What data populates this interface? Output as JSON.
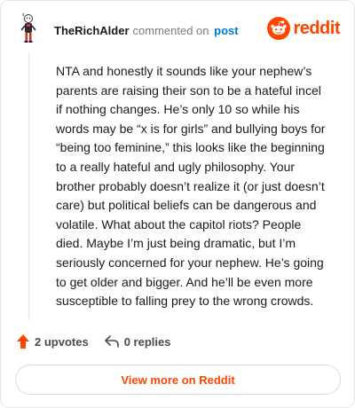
{
  "header": {
    "username": "TheRichAlder",
    "action_text": "commented on",
    "target_link": "post"
  },
  "brand": {
    "wordmark": "reddit",
    "logo_icon": "reddit-snoo-icon",
    "accent_color": "#ff4500"
  },
  "comment": {
    "lines": [
      "NTA and honestly it sounds like your nephew’s",
      "parents are raising their son to be a hateful incel",
      "if nothing changes. He’s only 10 so while his",
      "words may be “x is for girls” and bullying boys for",
      "“being too feminine,” this looks like the beginning",
      "to a really hateful and ugly philosophy. Your",
      "brother probably doesn’t realize it (or just doesn’t",
      "care) but political beliefs can be dangerous and",
      "volatile. What about the capitol riots? People",
      "died. Maybe I’m just being dramatic, but I’m",
      "seriously concerned for your nephew. He’s going",
      "to get older and bigger. And he’ll be even more",
      "susceptible to falling prey to the wrong crowds."
    ]
  },
  "actions": {
    "upvotes_label": "2 upvotes",
    "upvote_icon": "upvote-arrow-icon",
    "replies_label": "0 replies",
    "reply_icon": "reply-arrow-icon"
  },
  "footer": {
    "view_more_label": "View more on Reddit"
  }
}
